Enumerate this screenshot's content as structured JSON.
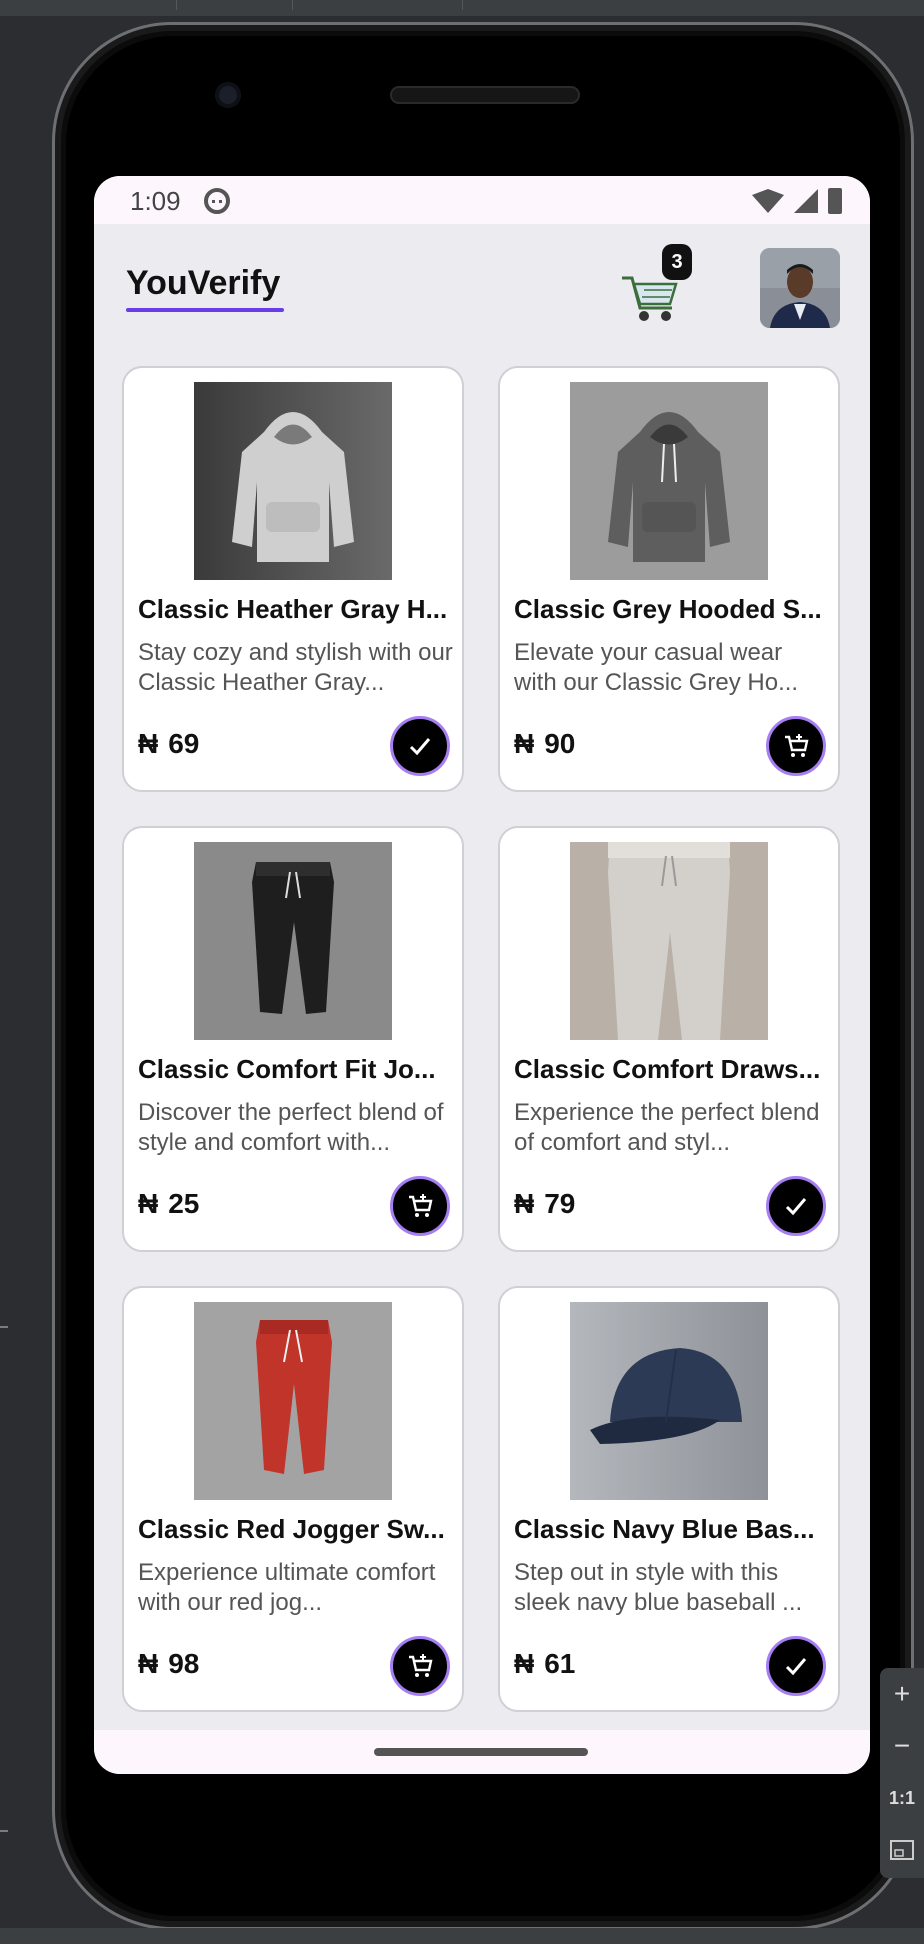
{
  "status_bar": {
    "time": "1:09"
  },
  "app_bar": {
    "brand": "YouVerify",
    "cart_count": "3"
  },
  "currency": "₦",
  "products": [
    {
      "title": "Classic Heather Gray H...",
      "description": "Stay cozy and stylish with our Classic Heather Gray...",
      "price": "69",
      "action": "check",
      "image": "light-gray-hoodie"
    },
    {
      "title": "Classic Grey Hooded S...",
      "description": "Elevate your casual wear with our Classic Grey Ho...",
      "price": "90",
      "action": "add-to-cart",
      "image": "dark-gray-hoodie"
    },
    {
      "title": "Classic Comfort Fit Jo...",
      "description": "Discover the perfect blend of style and comfort with...",
      "price": "25",
      "action": "add-to-cart",
      "image": "black-joggers"
    },
    {
      "title": "Classic Comfort Draws...",
      "description": "Experience the perfect blend of comfort and styl...",
      "price": "79",
      "action": "check",
      "image": "beige-drawstring-pants"
    },
    {
      "title": "Classic Red Jogger Sw...",
      "description": "Experience ultimate comfort with our red jog...",
      "price": "98",
      "action": "add-to-cart",
      "image": "red-joggers"
    },
    {
      "title": "Classic Navy Blue Bas...",
      "description": "Step out in style with this sleek navy blue baseball ...",
      "price": "61",
      "action": "check",
      "image": "navy-baseball-cap"
    }
  ],
  "zoom_controls": {
    "zoom_in": "+",
    "zoom_out": "−",
    "actual_size": "1:1"
  },
  "colors": {
    "accent": "#6a3de8",
    "action_ring": "#a67ef2",
    "screen_bg": "#ebebf0"
  }
}
